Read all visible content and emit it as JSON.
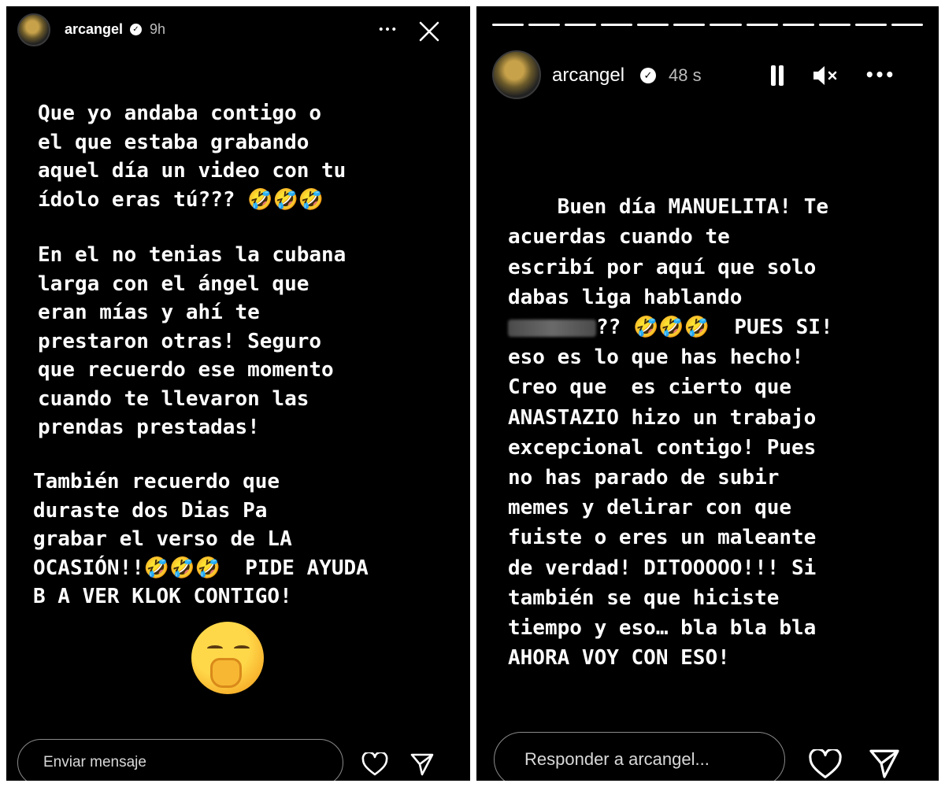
{
  "left": {
    "username": "arcangel",
    "verified_glyph": "✓",
    "time": "9h",
    "more_glyph": "•••",
    "close_glyph": "✕",
    "paragraphs": [
      "Que yo andaba contigo o\nel que estaba grabando\naquel día un video con tu\nídolo eras tú??? 🤣🤣🤣",
      "En el no tenias la cubana\nlarga con el ángel que\neran mías y ahí te\nprestaron otras! Seguro\nque recuerdo ese momento\ncuando te llevaron las\nprendas prestadas!",
      "También recuerdo que\nduraste dos Dias Pa\ngrabar el verso de LA\nOCASIÓN!!🤣🤣🤣  PIDE AYUDA\nB A VER KLOK CONTIGO!"
    ],
    "big_emoji": "yawning-face",
    "reply_placeholder": "Enviar mensaje",
    "icons": {
      "like": "heart-icon",
      "send": "send-icon"
    }
  },
  "right": {
    "username": "arcangel",
    "verified_glyph": "✓",
    "time": "48 s",
    "pause_glyph": "❚❚",
    "mute_glyph": "🔇",
    "more_glyph": "•••",
    "progress_segments": 12,
    "text_before_blur": "Buen día MANUELITA! Te\nacuerdas cuando te\nescribí por aquí que solo\ndabas liga hablando\n",
    "text_after_blur": "?? 🤣🤣🤣  PUES SI!\neso es lo que has hecho!\nCreo que  es cierto que\nANASTAZIO hizo un trabajo\nexcepcional contigo! Pues\nno has parado de subir\nmemes y delirar con que\nfuiste o eres un maleante\nde verdad! DITOOOOO!!! Si\ntambién se que hiciste\ntiempo y eso… bla bla bla\nAHORA VOY CON ESO!",
    "reply_placeholder": "Responder a arcangel...",
    "icons": {
      "like": "heart-icon",
      "send": "send-icon"
    }
  }
}
